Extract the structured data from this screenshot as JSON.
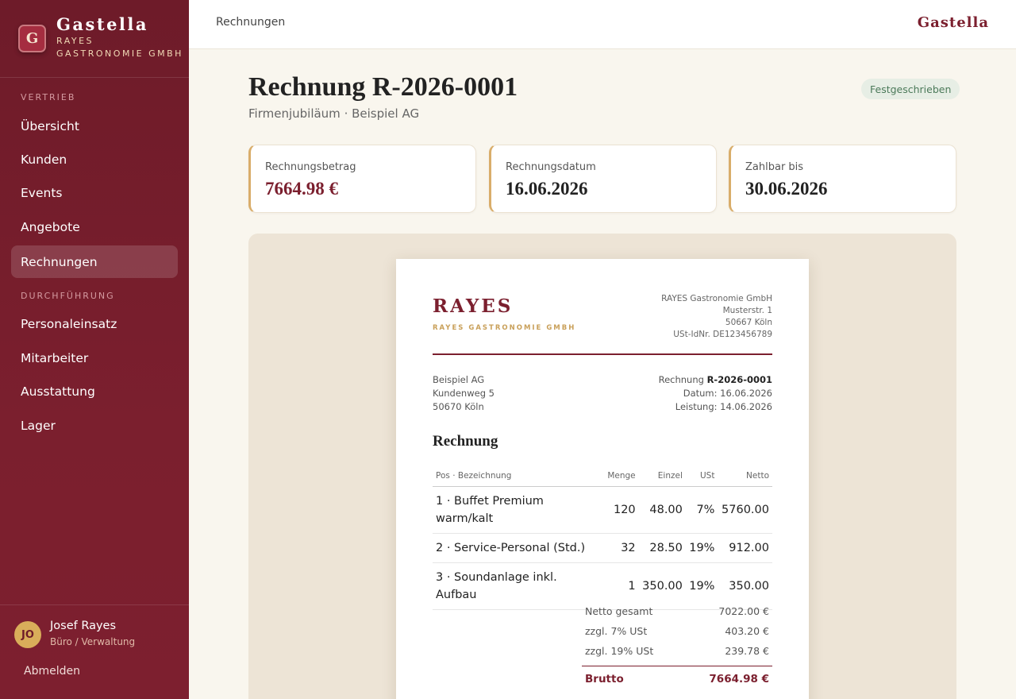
{
  "brand": {
    "logo_letter": "G",
    "name": "Gastella",
    "sub_line1": "RAYES",
    "sub_line2": "GASTRONOMIE GMBH"
  },
  "sidebar": {
    "sections": [
      {
        "label": "VERTRIEB"
      },
      {
        "label": "DURCHFÜHRUNG"
      }
    ],
    "items": [
      {
        "label": "Übersicht"
      },
      {
        "label": "Kunden"
      },
      {
        "label": "Events"
      },
      {
        "label": "Angebote"
      },
      {
        "label": "Rechnungen",
        "active": true
      },
      {
        "label": "Personaleinsatz"
      },
      {
        "label": "Mitarbeiter"
      },
      {
        "label": "Ausstattung"
      },
      {
        "label": "Lager"
      }
    ],
    "user": {
      "initials": "JO",
      "name": "Josef Rayes",
      "role": "Büro / Verwaltung"
    },
    "logout_label": "Abmelden"
  },
  "header": {
    "breadcrumb": "Rechnungen",
    "brand": "Gastella"
  },
  "page": {
    "title": "Rechnung R-2026-0001",
    "subtitle": "Firmenjubiläum · Beispiel AG",
    "status": "Festgeschrieben"
  },
  "cards": [
    {
      "label": "Rechnungsbetrag",
      "value": "7664.98 €"
    },
    {
      "label": "Rechnungsdatum",
      "value": "16.06.2026"
    },
    {
      "label": "Zahlbar bis",
      "value": "30.06.2026"
    }
  ],
  "invoice": {
    "logo": "RAYES",
    "logo_sub": "RAYES GASTRONOMIE GMBH",
    "sender": [
      "RAYES Gastronomie GmbH",
      "Musterstr. 1",
      "50667 Köln",
      "USt-IdNr. DE123456789"
    ],
    "recipient": [
      "Beispiel AG",
      "Kundenweg 5",
      "50670 Köln"
    ],
    "meta": {
      "number_label": "Rechnung",
      "number": "R-2026-0001",
      "date": "Datum: 16.06.2026",
      "service": "Leistung: 14.06.2026"
    },
    "heading": "Rechnung",
    "columns": [
      "Pos · Bezeichnung",
      "Menge",
      "Einzel",
      "USt",
      "Netto"
    ],
    "rows": [
      [
        "1 · Buffet Premium warm/kalt",
        "120",
        "48.00",
        "7%",
        "5760.00"
      ],
      [
        "2 · Service-Personal (Std.)",
        "32",
        "28.50",
        "19%",
        "912.00"
      ],
      [
        "3 · Soundanlage inkl. Aufbau",
        "1",
        "350.00",
        "19%",
        "350.00"
      ]
    ],
    "totals": [
      {
        "label": "Netto gesamt",
        "value": "7022.00 €"
      },
      {
        "label": "zzgl. 7% USt",
        "value": "403.20 €"
      },
      {
        "label": "zzgl. 19% USt",
        "value": "239.78 €"
      }
    ],
    "gross": {
      "label": "Brutto",
      "value": "7664.98 €"
    }
  },
  "colors": {
    "brand": "#7b1f2e",
    "accent_gold": "#d9ad6a",
    "status_green": "#4c7a5a"
  }
}
